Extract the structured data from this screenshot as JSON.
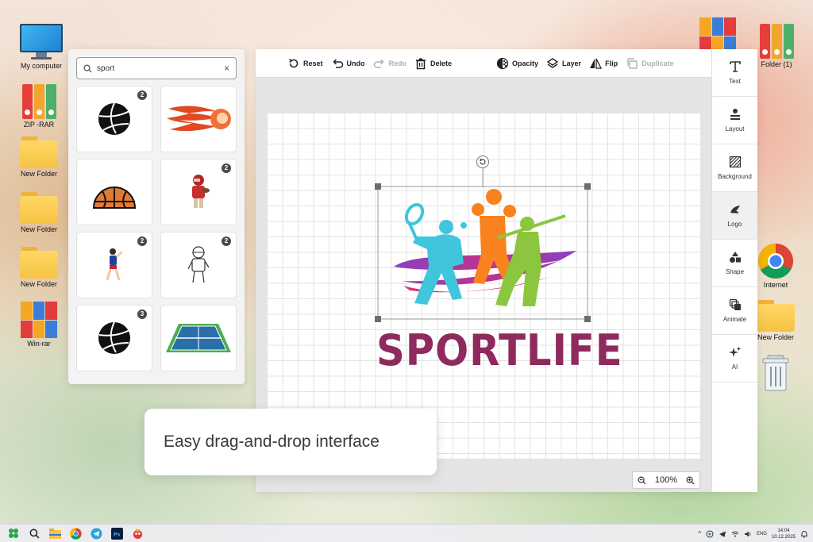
{
  "desktop": {
    "left_icons": [
      {
        "label": "My computer",
        "icon": "monitor-icon"
      },
      {
        "label": "ZIP -RAR",
        "icon": "binder-icon"
      },
      {
        "label": "New Folder",
        "icon": "folder-icon"
      },
      {
        "label": "New Folder",
        "icon": "folder-icon"
      },
      {
        "label": "New Folder",
        "icon": "folder-icon"
      },
      {
        "label": "Win-rar",
        "icon": "winrar-icon"
      }
    ],
    "right_icons": [
      {
        "label": "",
        "icon": "winrar-icon"
      },
      {
        "label": "Folder (1)",
        "icon": "binder-icon"
      },
      {
        "label": "Internet",
        "icon": "chrome-icon"
      },
      {
        "label": "New Folder",
        "icon": "folder-icon"
      },
      {
        "label": "",
        "icon": "recycle-bin-icon"
      }
    ]
  },
  "search": {
    "value": "sport",
    "clear_label": "×",
    "results": [
      {
        "icon": "volleyball-icon",
        "badge": "2"
      },
      {
        "icon": "fire-ball-icon",
        "badge": ""
      },
      {
        "icon": "basketball-icon",
        "badge": ""
      },
      {
        "icon": "football-player-icon",
        "badge": "2"
      },
      {
        "icon": "volleyball-player-icon",
        "badge": "2"
      },
      {
        "icon": "athlete-sketch-icon",
        "badge": "2"
      },
      {
        "icon": "volleyball-icon",
        "badge": "3"
      },
      {
        "icon": "tennis-court-icon",
        "badge": ""
      }
    ]
  },
  "toolbar": {
    "reset": "Reset",
    "undo": "Undo",
    "redo": "Redo",
    "delete": "Delete",
    "opacity": "Opacity",
    "layer": "Layer",
    "flip": "Flip",
    "duplicate": "Duplicate"
  },
  "sidebar": {
    "items": [
      {
        "label": "Text",
        "icon": "text-icon"
      },
      {
        "label": "Layout",
        "icon": "layout-icon"
      },
      {
        "label": "Background",
        "icon": "background-icon"
      },
      {
        "label": "Logo",
        "icon": "logo-icon"
      },
      {
        "label": "Shape",
        "icon": "shape-icon"
      },
      {
        "label": "Animate",
        "icon": "animate-icon"
      },
      {
        "label": "AI",
        "icon": "ai-sparkle-icon"
      }
    ],
    "active": "Logo"
  },
  "canvas": {
    "logo_text": "SPORTLIFE",
    "colors": {
      "logo_text": "#8e2a5e",
      "cyan": "#3fc6dc",
      "orange": "#f7821e",
      "green": "#8cc63f",
      "magenta": "#c0338c",
      "purple": "#8a3fc4"
    }
  },
  "zoom": {
    "level": "100%",
    "minus_label": "−",
    "plus_label": "+"
  },
  "caption": {
    "text": "Easy drag-and-drop interface"
  },
  "taskbar": {
    "lang": "ENG",
    "time": "14:04",
    "date": "10.12.2025"
  }
}
